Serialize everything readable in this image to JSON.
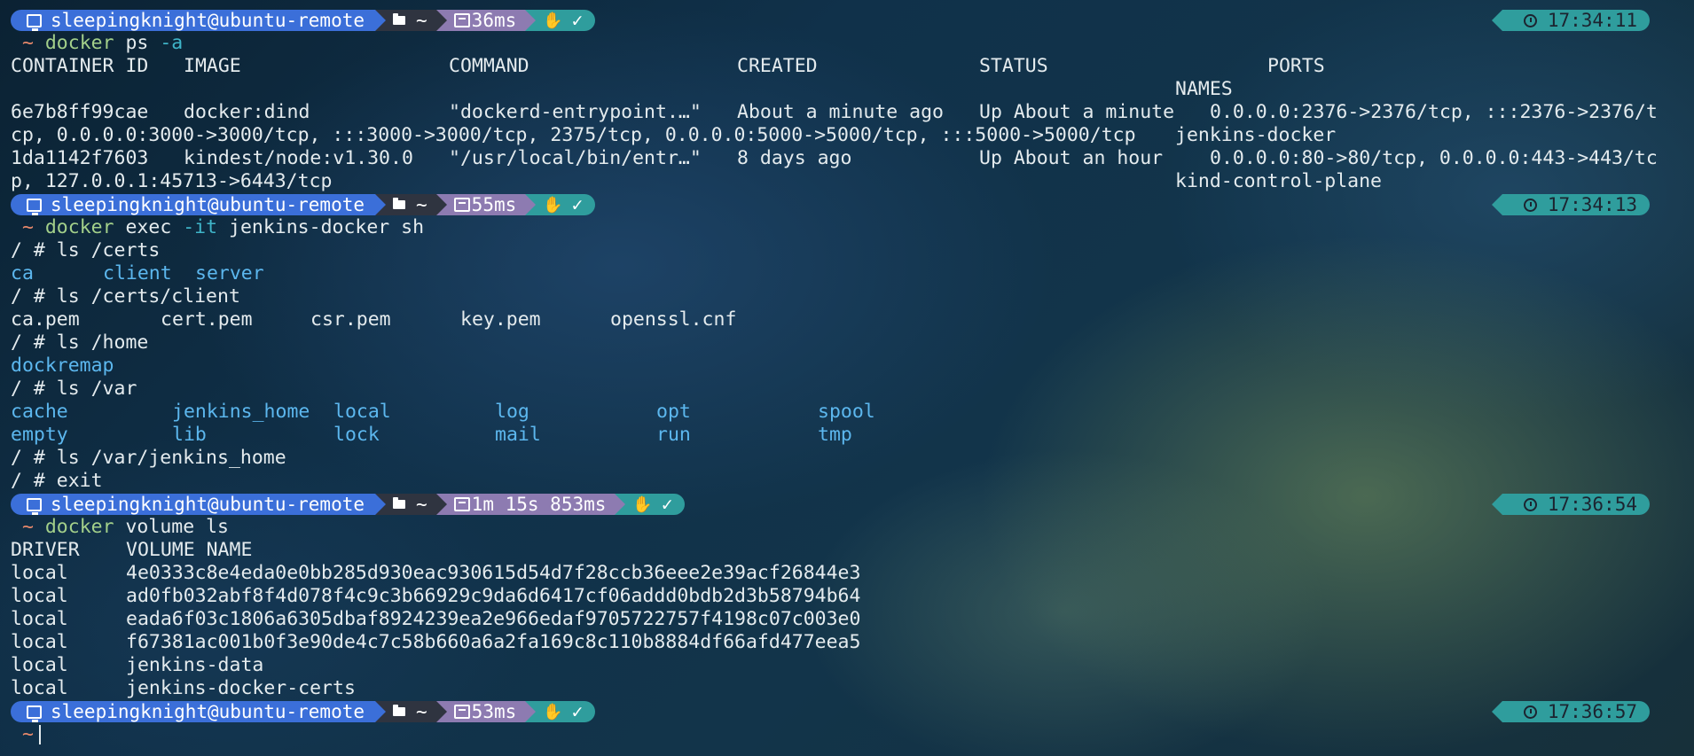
{
  "prompt": {
    "user_host": "sleepingknight@ubuntu-remote",
    "directory": "~",
    "status_check": "✓"
  },
  "blocks": [
    {
      "duration": "36ms",
      "clock": "17:34:11",
      "command": {
        "name": "docker",
        "args": "ps",
        "flag": "-a",
        "rest": ""
      },
      "output": {
        "headers": [
          "CONTAINER ID",
          "IMAGE",
          "COMMAND",
          "CREATED",
          "STATUS",
          "PORTS",
          "NAMES"
        ],
        "rows": [
          {
            "id": "6e7b8ff99cae",
            "image": "docker:dind",
            "command": "\"dockerd-entrypoint.…\"",
            "created": "About a minute ago",
            "status": "Up About a minute",
            "ports_line1": "0.0.0.0:2376->2376/tcp, :::2376->2376/t",
            "ports_line2": "cp, 0.0.0.0:3000->3000/tcp, :::3000->3000/tcp, 2375/tcp, 0.0.0.0:5000->5000/tcp, :::5000->5000/tcp",
            "name": "jenkins-docker"
          },
          {
            "id": "1da1142f7603",
            "image": "kindest/node:v1.30.0",
            "command": "\"/usr/local/bin/entr…\"",
            "created": "8 days ago",
            "status": "Up About an hour",
            "ports_line1": "0.0.0.0:80->80/tcp, 0.0.0.0:443->443/tc",
            "ports_line2": "p, 127.0.0.1:45713->6443/tcp",
            "name": "kind-control-plane"
          }
        ]
      }
    },
    {
      "duration": "55ms",
      "clock": "17:34:13",
      "command": {
        "name": "docker",
        "args": "exec",
        "flag": "-it",
        "rest": "jenkins-docker sh"
      },
      "shell": {
        "prompt": "/ # ",
        "cmd_ls_certs": "ls /certs",
        "certs_dirs": [
          "ca",
          "client",
          "server"
        ],
        "cmd_ls_client": "ls /certs/client",
        "client_files": [
          "ca.pem",
          "cert.pem",
          "csr.pem",
          "key.pem",
          "openssl.cnf"
        ],
        "cmd_ls_home": "ls /home",
        "home_dirs": [
          "dockremap"
        ],
        "cmd_ls_var": "ls /var",
        "var_row1": [
          "cache",
          "jenkins_home",
          "local",
          "log",
          "opt",
          "spool"
        ],
        "var_row2": [
          "empty",
          "lib",
          "lock",
          "mail",
          "run",
          "tmp"
        ],
        "cmd_ls_jenkins": "ls /var/jenkins_home",
        "cmd_exit": "exit"
      }
    },
    {
      "duration": "1m 15s 853ms",
      "clock": "17:36:54",
      "command": {
        "name": "docker",
        "args": "volume ls",
        "flag": "",
        "rest": ""
      },
      "volumes": {
        "headers": [
          "DRIVER",
          "VOLUME NAME"
        ],
        "rows": [
          {
            "driver": "local",
            "name": "4e0333c8e4eda0e0bb285d930eac930615d54d7f28ccb36eee2e39acf26844e3"
          },
          {
            "driver": "local",
            "name": "ad0fb032abf8f4d078f4c9c3b66929c9da6d6417cf06addd0bdb2d3b58794b64"
          },
          {
            "driver": "local",
            "name": "eada6f03c1806a6305dbaf8924239ea2e966edaf9705722757f4198c07c003e0"
          },
          {
            "driver": "local",
            "name": "f67381ac001b0f3e90de4c7c58b660a6a2fa169c8c110b8884df66afd477eea5"
          },
          {
            "driver": "local",
            "name": "jenkins-data"
          },
          {
            "driver": "local",
            "name": "jenkins-docker-certs"
          }
        ]
      }
    },
    {
      "duration": "53ms",
      "clock": "17:36:57"
    }
  ],
  "icons": {
    "user_segment": "ubuntu-icon",
    "dir_segment": "folder-icon",
    "time_segment": "timer-icon",
    "status_segment": "hand-icon",
    "clock_segment": "clock-icon"
  },
  "colors": {
    "user_segment": "#3b6fd9",
    "dir_segment": "#2f3440",
    "time_segment": "#8d7bb1",
    "status_segment": "#2f9d9d",
    "tilde": "#e9896b",
    "command": "#a3d08a",
    "flag": "#3fb5c9",
    "directory_listing": "#5cb7ee"
  }
}
